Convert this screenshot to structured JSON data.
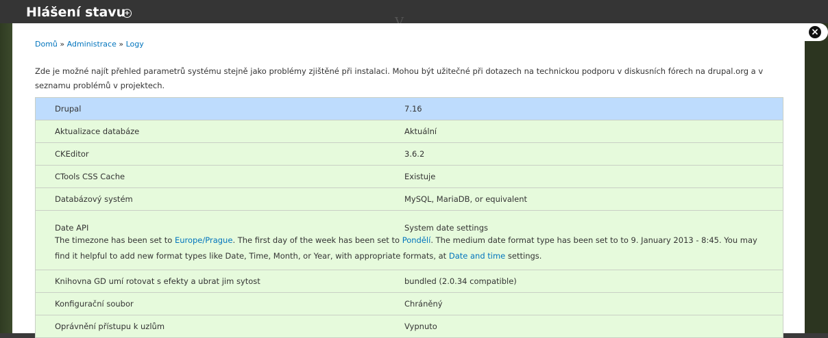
{
  "overlay": {
    "title": "Hlášení stavu",
    "shortcut_symbol": "+"
  },
  "background": {
    "logo_text": "V..."
  },
  "close_symbol": "×",
  "breadcrumb": {
    "items": [
      "Domů",
      "Administrace",
      "Logy"
    ],
    "separator": "»"
  },
  "intro": "Zde je možné najít přehled parametrů systému stejně jako problémy zjištěné při instalaci. Mohou být užitečné při dotazech na technickou podporu v diskusních fórech na drupal.org a v seznamu problémů v projektech.",
  "rows": [
    {
      "title": "Drupal",
      "value": "7.16"
    },
    {
      "title": "Aktualizace databáze",
      "value": "Aktuální"
    },
    {
      "title": "CKEditor",
      "value": "3.6.2"
    },
    {
      "title": "CTools CSS Cache",
      "value": "Existuje"
    },
    {
      "title": "Databázový systém",
      "value": "MySQL, MariaDB, or equivalent"
    },
    {
      "title": "Date API",
      "value": "System date settings"
    },
    {
      "title": "Knihovna GD umí rotovat s efekty a ubrat jim sytost",
      "value": "bundled (2.0.34 compatible)"
    },
    {
      "title": "Konfigurační soubor",
      "value": "Chráněný"
    },
    {
      "title": "Oprávnění přístupu k uzlům",
      "value": "Vypnuto"
    }
  ],
  "date_api_desc": {
    "part1": "The timezone has been set to ",
    "link_timezone": "Europe/Prague",
    "part2": ". The first day of the week has been set to ",
    "link_day": "Pondělí",
    "part3": ". The medium date format type has been set to to 9. January 2013 - 8:45. You may find it helpful to add new format types like Date, Time, Month, or Year, with appropriate formats, at ",
    "link_settings": "Date and time",
    "part4": " settings."
  },
  "colors": {
    "info_row": "#bedcfd",
    "ok_row": "#e6fadc",
    "link": "#0074bd"
  }
}
